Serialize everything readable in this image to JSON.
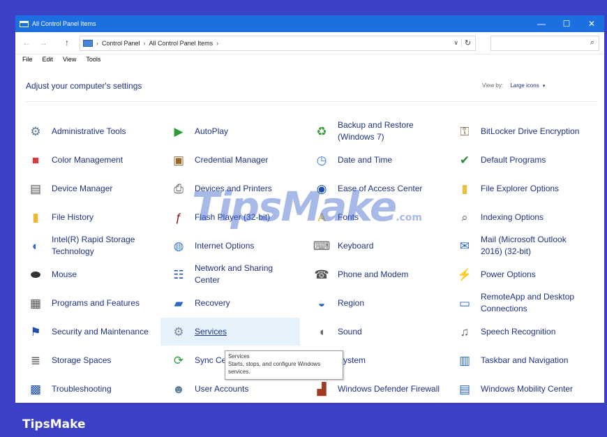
{
  "window": {
    "title": "All Control Panel Items"
  },
  "titlebar_controls": {
    "minimize": "—",
    "maximize": "☐",
    "close": "✕"
  },
  "address": {
    "back": "←",
    "forward": "→",
    "up": "↑",
    "crumbs": [
      "Control Panel",
      "All Control Panel Items"
    ],
    "separator": "›",
    "dropdown": "∨",
    "refresh": "↻",
    "search_placeholder": "",
    "search_icon": "⌕"
  },
  "menu": [
    "File",
    "Edit",
    "View",
    "Tools"
  ],
  "header": {
    "title": "Adjust your computer's settings",
    "view_by_label": "View by:",
    "view_by_value": "Large icons",
    "view_by_caret": "▾"
  },
  "items": [
    {
      "label": "Administrative Tools",
      "icon": "administrative-tools-icon",
      "glyph": "⚙",
      "color": "#5a7a9a"
    },
    {
      "label": "AutoPlay",
      "icon": "autoplay-icon",
      "glyph": "▶",
      "color": "#2e9b3d"
    },
    {
      "label": "Backup and Restore (Windows 7)",
      "icon": "backup-restore-icon",
      "glyph": "♻",
      "color": "#3a9a3a"
    },
    {
      "label": "BitLocker Drive Encryption",
      "icon": "bitlocker-icon",
      "glyph": "⚿",
      "color": "#8a7a55"
    },
    {
      "label": "Color Management",
      "icon": "color-management-icon",
      "glyph": "■",
      "color": "#d83a3a"
    },
    {
      "label": "Credential Manager",
      "icon": "credential-manager-icon",
      "glyph": "▣",
      "color": "#9a6a2a"
    },
    {
      "label": "Date and Time",
      "icon": "date-time-icon",
      "glyph": "◷",
      "color": "#3a7ad8"
    },
    {
      "label": "Default Programs",
      "icon": "default-programs-icon",
      "glyph": "✔",
      "color": "#2e8b3d"
    },
    {
      "label": "Device Manager",
      "icon": "device-manager-icon",
      "glyph": "▤",
      "color": "#555555"
    },
    {
      "label": "Devices and Printers",
      "icon": "devices-printers-icon",
      "glyph": "⎙",
      "color": "#555555"
    },
    {
      "label": "Ease of Access Center",
      "icon": "ease-of-access-icon",
      "glyph": "◉",
      "color": "#1e4fb0"
    },
    {
      "label": "File Explorer Options",
      "icon": "file-explorer-options-icon",
      "glyph": "▮",
      "color": "#e8c040"
    },
    {
      "label": "File History",
      "icon": "file-history-icon",
      "glyph": "▮",
      "color": "#e8b830"
    },
    {
      "label": "Flash Player (32-bit)",
      "icon": "flash-player-icon",
      "glyph": "ƒ",
      "color": "#8a1010"
    },
    {
      "label": "Fonts",
      "icon": "fonts-icon",
      "glyph": "A",
      "color": "#e8b830"
    },
    {
      "label": "Indexing Options",
      "icon": "indexing-options-icon",
      "glyph": "⌕",
      "color": "#666666"
    },
    {
      "label": "Intel(R) Rapid Storage Technology",
      "icon": "intel-storage-icon",
      "glyph": "◐",
      "color": "#2a6ac0"
    },
    {
      "label": "Internet Options",
      "icon": "internet-options-icon",
      "glyph": "◍",
      "color": "#3a7ad8"
    },
    {
      "label": "Keyboard",
      "icon": "keyboard-icon",
      "glyph": "⌨",
      "color": "#666666"
    },
    {
      "label": "Mail (Microsoft Outlook 2016) (32-bit)",
      "icon": "mail-icon",
      "glyph": "✉",
      "color": "#2a6ac0"
    },
    {
      "label": "Mouse",
      "icon": "mouse-icon",
      "glyph": "⬬",
      "color": "#333333"
    },
    {
      "label": "Network and Sharing Center",
      "icon": "network-sharing-icon",
      "glyph": "☷",
      "color": "#1e4fb0"
    },
    {
      "label": "Phone and Modem",
      "icon": "phone-modem-icon",
      "glyph": "☎",
      "color": "#555555"
    },
    {
      "label": "Power Options",
      "icon": "power-options-icon",
      "glyph": "⚡",
      "color": "#2e9b3d"
    },
    {
      "label": "Programs and Features",
      "icon": "programs-features-icon",
      "glyph": "▦",
      "color": "#555555"
    },
    {
      "label": "Recovery",
      "icon": "recovery-icon",
      "glyph": "▰",
      "color": "#2a6ac0"
    },
    {
      "label": "Region",
      "icon": "region-icon",
      "glyph": "◒",
      "color": "#2a6ac0"
    },
    {
      "label": "RemoteApp and Desktop Connections",
      "icon": "remoteapp-icon",
      "glyph": "▭",
      "color": "#2a6ac0"
    },
    {
      "label": "Security and Maintenance",
      "icon": "security-maintenance-icon",
      "glyph": "⚑",
      "color": "#1e4fb0"
    },
    {
      "label": "Services",
      "icon": "services-icon",
      "glyph": "⚙",
      "color": "#7a8a9a"
    },
    {
      "label": "Sound",
      "icon": "sound-icon",
      "glyph": "◖",
      "color": "#666666"
    },
    {
      "label": "Speech Recognition",
      "icon": "speech-recognition-icon",
      "glyph": "♫",
      "color": "#666666"
    },
    {
      "label": "Storage Spaces",
      "icon": "storage-spaces-icon",
      "glyph": "≣",
      "color": "#666666"
    },
    {
      "label": "Sync Center",
      "icon": "sync-center-icon",
      "glyph": "⟳",
      "color": "#2e9b3d"
    },
    {
      "label": "System",
      "icon": "system-icon",
      "glyph": "▣",
      "color": "#2a6ac0"
    },
    {
      "label": "Taskbar and Navigation",
      "icon": "taskbar-navigation-icon",
      "glyph": "▥",
      "color": "#2a6ac0"
    },
    {
      "label": "Troubleshooting",
      "icon": "troubleshooting-icon",
      "glyph": "▩",
      "color": "#1e4fb0"
    },
    {
      "label": "User Accounts",
      "icon": "user-accounts-icon",
      "glyph": "☻",
      "color": "#5a7a9a"
    },
    {
      "label": "Windows Defender Firewall",
      "icon": "windows-firewall-icon",
      "glyph": "▟",
      "color": "#a03a20"
    },
    {
      "label": "Windows Mobility Center",
      "icon": "mobility-center-icon",
      "glyph": "▤",
      "color": "#2a6ac0"
    }
  ],
  "hovered_item": "Services",
  "tooltip": {
    "title": "Services",
    "text": "Starts, stops, and configure Windows services."
  },
  "watermark": {
    "main": "TipsMake",
    "suffix": ".com"
  },
  "brand": "TipsMake"
}
